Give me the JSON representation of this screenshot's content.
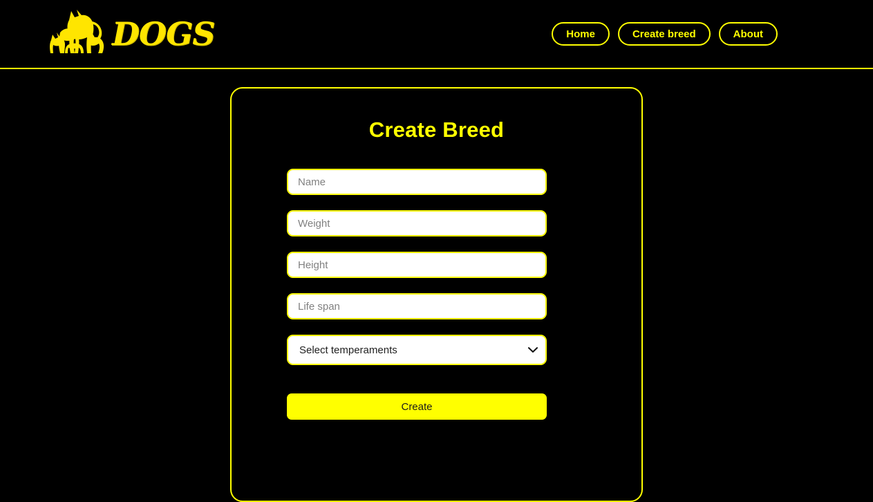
{
  "header": {
    "logo": {
      "icon": "dogs-silhouette-icon",
      "wordmark": "DOGS"
    },
    "nav": [
      {
        "id": "home",
        "label": "Home"
      },
      {
        "id": "create-breed",
        "label": "Create breed"
      },
      {
        "id": "about",
        "label": "About"
      }
    ]
  },
  "form_card": {
    "title": "Create Breed",
    "fields": [
      {
        "id": "name",
        "placeholder": "Name",
        "value": ""
      },
      {
        "id": "weight",
        "placeholder": "Weight",
        "value": ""
      },
      {
        "id": "height",
        "placeholder": "Height",
        "value": ""
      },
      {
        "id": "life-span",
        "placeholder": "Life span",
        "value": ""
      }
    ],
    "temperaments_select": {
      "selected_label": "Select temperaments",
      "chevron_icon": "chevron-down-icon"
    },
    "submit_label": "Create"
  },
  "colors": {
    "background": "#000000",
    "accent": "#ffff00",
    "field_background": "#ffffff",
    "placeholder": "#808080",
    "button_text": "#1a1a1a"
  }
}
